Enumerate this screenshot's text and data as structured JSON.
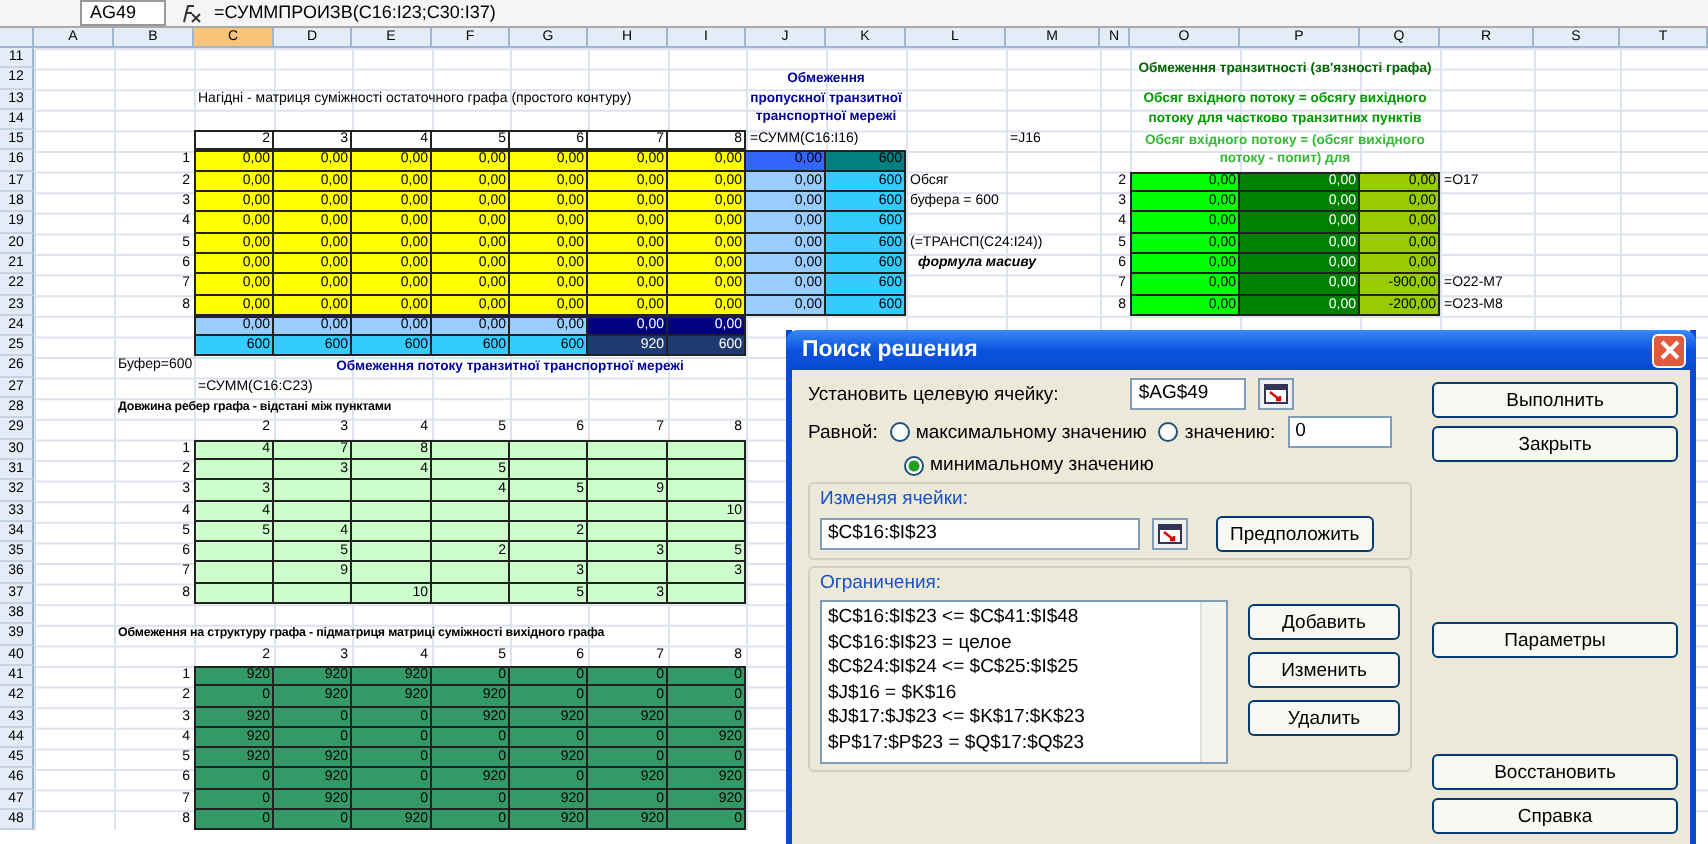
{
  "formula_bar": {
    "name_box": "AG49",
    "formula": "=СУММПРОИЗВ(C16:I23;C30:I37)"
  },
  "sheet": {
    "columns": [
      "A",
      "B",
      "C",
      "D",
      "E",
      "F",
      "G",
      "H",
      "I",
      "J",
      "K",
      "L",
      "M",
      "N",
      "O",
      "P",
      "Q",
      "R",
      "S",
      "T"
    ],
    "row_numbers": [
      "11",
      "12",
      "13",
      "14",
      "15",
      "16",
      "17",
      "18",
      "19",
      "20",
      "21",
      "22",
      "23",
      "24",
      "25",
      "26",
      "27",
      "28",
      "29",
      "30",
      "31",
      "32",
      "33",
      "34",
      "35",
      "36",
      "37",
      "38",
      "39",
      "40",
      "41",
      "42",
      "43",
      "44",
      "45",
      "46",
      "47",
      "48"
    ],
    "adjacency": {
      "title": "Нагідні - матриця суміжності остаточного графа (простого контуру)",
      "headers": [
        "2",
        "3",
        "4",
        "5",
        "6",
        "7",
        "8"
      ],
      "rows": [
        {
          "label": "1",
          "values": [
            "0,00",
            "0,00",
            "0,00",
            "0,00",
            "0,00",
            "0,00",
            "0,00"
          ]
        },
        {
          "label": "2",
          "values": [
            "0,00",
            "0,00",
            "0,00",
            "0,00",
            "0,00",
            "0,00",
            "0,00"
          ]
        },
        {
          "label": "3",
          "values": [
            "0,00",
            "0,00",
            "0,00",
            "0,00",
            "0,00",
            "0,00",
            "0,00"
          ]
        },
        {
          "label": "4",
          "values": [
            "0,00",
            "0,00",
            "0,00",
            "0,00",
            "0,00",
            "0,00",
            "0,00"
          ]
        },
        {
          "label": "5",
          "values": [
            "0,00",
            "0,00",
            "0,00",
            "0,00",
            "0,00",
            "0,00",
            "0,00"
          ]
        },
        {
          "label": "6",
          "values": [
            "0,00",
            "0,00",
            "0,00",
            "0,00",
            "0,00",
            "0,00",
            "0,00"
          ]
        },
        {
          "label": "7",
          "values": [
            "0,00",
            "0,00",
            "0,00",
            "0,00",
            "0,00",
            "0,00",
            "0,00"
          ]
        },
        {
          "label": "8",
          "values": [
            "0,00",
            "0,00",
            "0,00",
            "0,00",
            "0,00",
            "0,00",
            "0,00"
          ]
        }
      ]
    },
    "flow_limit": {
      "title": "Обмеження пропускної транзитної транспортної мережі",
      "formula": "=СУММ(C16:I16)",
      "sums": [
        "0,00",
        "0,00",
        "0,00",
        "0,00",
        "0,00",
        "0,00",
        "0,00",
        "0,00"
      ],
      "capacities": [
        "600",
        "600",
        "600",
        "600",
        "600",
        "600",
        "600",
        "600"
      ]
    },
    "notes": {
      "link": "=J16",
      "buffer": [
        "Обсяг",
        "буфера = 600"
      ],
      "transpose": "(=ТРАНСП(C24:I24))",
      "array_caption": "формула масиву"
    },
    "transit": {
      "title": "Обмеження транзитності (зв'язності графа)",
      "subtitle": "Обсяг вхідного потоку = обсягу вихідного потоку для частково транзитних пунктів",
      "note": "Обсяг вхідного потоку = (обсяг вихідного потоку - попит) для",
      "rows": [
        {
          "label": "2",
          "inflow": "0,00",
          "outflow": "0,00",
          "balance": "0,00",
          "check": "=O17"
        },
        {
          "label": "3",
          "inflow": "0,00",
          "outflow": "0,00",
          "balance": "0,00"
        },
        {
          "label": "4",
          "inflow": "0,00",
          "outflow": "0,00",
          "balance": "0,00"
        },
        {
          "label": "5",
          "inflow": "0,00",
          "outflow": "0,00",
          "balance": "0,00"
        },
        {
          "label": "6",
          "inflow": "0,00",
          "outflow": "0,00",
          "balance": "0,00"
        },
        {
          "label": "7",
          "inflow": "0,00",
          "outflow": "0,00",
          "balance": "-900,00",
          "check": "=O22-M7"
        },
        {
          "label": "8",
          "inflow": "0,00",
          "outflow": "0,00",
          "balance": "-200,00",
          "check": "=O23-M8"
        }
      ]
    },
    "totals": {
      "sums": [
        "0,00",
        "0,00",
        "0,00",
        "0,00",
        "0,00",
        "0,00",
        "0,00"
      ],
      "limits": [
        "600",
        "600",
        "600",
        "600",
        "600",
        "920",
        "600"
      ],
      "buffer_label": "Буфер=600",
      "title": "Обмеження потоку транзитної транспортної мережі",
      "formula": "=СУММ(C16:C23)"
    },
    "distances": {
      "title": "Довжина ребер графа - відстані між пунктами",
      "headers": [
        "2",
        "3",
        "4",
        "5",
        "6",
        "7",
        "8"
      ],
      "rows": [
        {
          "label": "1",
          "cells": [
            {
              "kind": "value",
              "value": "4"
            },
            {
              "kind": "value",
              "value": "7"
            },
            {
              "kind": "value",
              "value": "8"
            },
            {
              "kind": "blank"
            },
            {
              "kind": "blank"
            },
            {
              "kind": "blank"
            },
            {
              "kind": "blank"
            }
          ]
        },
        {
          "label": "2",
          "cells": [
            {
              "kind": "blank"
            },
            {
              "kind": "value",
              "value": "3"
            },
            {
              "kind": "value",
              "value": "4"
            },
            {
              "kind": "value",
              "value": "5"
            },
            {
              "kind": "blank"
            },
            {
              "kind": "blank"
            },
            {
              "kind": "blank"
            }
          ]
        },
        {
          "label": "3",
          "cells": [
            {
              "kind": "value",
              "value": "3"
            },
            {
              "kind": "blank"
            },
            {
              "kind": "blank"
            },
            {
              "kind": "value",
              "value": "4"
            },
            {
              "kind": "value",
              "value": "5"
            },
            {
              "kind": "value",
              "value": "9"
            },
            {
              "kind": "blank"
            }
          ]
        },
        {
          "label": "4",
          "cells": [
            {
              "kind": "value",
              "value": "4"
            },
            {
              "kind": "blank"
            },
            {
              "kind": "blank"
            },
            {
              "kind": "blank"
            },
            {
              "kind": "blank"
            },
            {
              "kind": "blank"
            },
            {
              "kind": "value",
              "value": "10"
            }
          ]
        },
        {
          "label": "5",
          "cells": [
            {
              "kind": "value",
              "value": "5"
            },
            {
              "kind": "value",
              "value": "4"
            },
            {
              "kind": "blank"
            },
            {
              "kind": "blank"
            },
            {
              "kind": "value",
              "value": "2"
            },
            {
              "kind": "blank"
            },
            {
              "kind": "blank"
            }
          ]
        },
        {
          "label": "6",
          "cells": [
            {
              "kind": "blank"
            },
            {
              "kind": "value",
              "value": "5"
            },
            {
              "kind": "blank"
            },
            {
              "kind": "value",
              "value": "2"
            },
            {
              "kind": "blank"
            },
            {
              "kind": "value",
              "value": "3"
            },
            {
              "kind": "value",
              "value": "5"
            }
          ]
        },
        {
          "label": "7",
          "cells": [
            {
              "kind": "blank"
            },
            {
              "kind": "value",
              "value": "9"
            },
            {
              "kind": "blank"
            },
            {
              "kind": "blank"
            },
            {
              "kind": "value",
              "value": "3"
            },
            {
              "kind": "blank"
            },
            {
              "kind": "value",
              "value": "3"
            }
          ]
        },
        {
          "label": "8",
          "cells": [
            {
              "kind": "blank"
            },
            {
              "kind": "blank"
            },
            {
              "kind": "value",
              "value": "10"
            },
            {
              "kind": "blank"
            },
            {
              "kind": "value",
              "value": "5"
            },
            {
              "kind": "value",
              "value": "3"
            },
            {
              "kind": "blank"
            }
          ]
        }
      ]
    },
    "structure": {
      "title": "Обмеження на структуру графа - підматриця матриці суміжності вихідного графа",
      "headers": [
        "2",
        "3",
        "4",
        "5",
        "6",
        "7",
        "8"
      ],
      "rows": [
        {
          "label": "1",
          "values": [
            "920",
            "920",
            "920",
            "0",
            "0",
            "0",
            "0"
          ]
        },
        {
          "label": "2",
          "values": [
            "0",
            "920",
            "920",
            "920",
            "0",
            "0",
            "0"
          ]
        },
        {
          "label": "3",
          "values": [
            "920",
            "0",
            "0",
            "920",
            "920",
            "920",
            "0"
          ]
        },
        {
          "label": "4",
          "values": [
            "920",
            "0",
            "0",
            "0",
            "0",
            "0",
            "920"
          ]
        },
        {
          "label": "5",
          "values": [
            "920",
            "920",
            "0",
            "0",
            "920",
            "0",
            "0"
          ]
        },
        {
          "label": "6",
          "values": [
            "0",
            "920",
            "0",
            "920",
            "0",
            "920",
            "920"
          ]
        },
        {
          "label": "7",
          "values": [
            "0",
            "920",
            "0",
            "0",
            "920",
            "0",
            "920"
          ]
        },
        {
          "label": "8",
          "values": [
            "0",
            "0",
            "920",
            "0",
            "920",
            "920",
            "0"
          ]
        }
      ]
    }
  },
  "dialog": {
    "title": "Поиск решения",
    "target": {
      "label": "Установить целевую ячейку:",
      "value": "$AG$49"
    },
    "equal_to": {
      "label": "Равной:",
      "options": [
        {
          "label": "максимальному значению",
          "selected": false
        },
        {
          "label": "значению:",
          "selected": false
        },
        {
          "label": "минимальному значению",
          "selected": true
        }
      ],
      "value": "0"
    },
    "changing": {
      "label": "Изменяя ячейки:",
      "value": "$C$16:$I$23",
      "button": "Предположить"
    },
    "constraints": {
      "label": "Ограничения:",
      "items": [
        "$C$16:$I$23 <= $C$41:$I$48",
        "$C$16:$I$23 = целое",
        "$C$24:$I$24 <= $C$25:$I$25",
        "$J$16 = $K$16",
        "$J$17:$J$23 <= $K$17:$K$23",
        "$P$17:$P$23 = $Q$17:$Q$23"
      ],
      "buttons": [
        "Добавить",
        "Изменить",
        "Удалить"
      ]
    },
    "side_buttons": [
      "Выполнить",
      "Закрыть",
      "Параметры",
      "Восстановить",
      "Справка"
    ]
  }
}
